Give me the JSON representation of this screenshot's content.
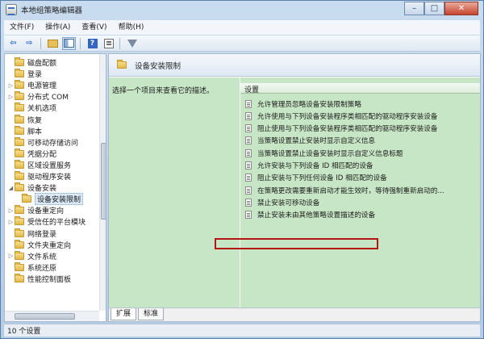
{
  "window": {
    "title": "本地组策略编辑器"
  },
  "caption": {
    "minimize": "–",
    "maximize": "□",
    "close": "✕"
  },
  "menu": [
    "文件(F)",
    "操作(A)",
    "查看(V)",
    "帮助(H)"
  ],
  "toolbar": {
    "icons": [
      "back-arrow-icon",
      "forward-arrow-icon",
      "folder-up-icon",
      "show-hide-tree-icon",
      "help-icon",
      "properties-icon",
      "filter-icon"
    ],
    "back": "⇦",
    "forward": "⇨",
    "help": "?"
  },
  "tree": {
    "items": [
      {
        "label": "磁盘配额",
        "expandable": false
      },
      {
        "label": "登录",
        "expandable": false
      },
      {
        "label": "电源管理",
        "expandable": true
      },
      {
        "label": "分布式 COM",
        "expandable": true
      },
      {
        "label": "关机选项",
        "expandable": false
      },
      {
        "label": "恢复",
        "expandable": false
      },
      {
        "label": "脚本",
        "expandable": false
      },
      {
        "label": "可移动存储访问",
        "expandable": false
      },
      {
        "label": "凭据分配",
        "expandable": false
      },
      {
        "label": "区域设置服务",
        "expandable": false
      },
      {
        "label": "驱动程序安装",
        "expandable": false
      },
      {
        "label": "设备安装",
        "expandable": true,
        "expanded": true
      },
      {
        "label": "设备安装限制",
        "child": true,
        "selected": true
      },
      {
        "label": "设备重定向",
        "expandable": true
      },
      {
        "label": "受信任的平台模块",
        "expandable": true
      },
      {
        "label": "网络登录",
        "expandable": false
      },
      {
        "label": "文件夹重定向",
        "expandable": false
      },
      {
        "label": "文件系统",
        "expandable": true
      },
      {
        "label": "系统还原",
        "expandable": false
      },
      {
        "label": "性能控制面板",
        "expandable": false
      }
    ],
    "expand_closed": "▷",
    "expand_open": "◢"
  },
  "details": {
    "title": "设备安装限制",
    "description": "选择一个项目来查看它的描述。",
    "column_header": "设置",
    "policies": [
      "允许管理员忽略设备安装限制策略",
      "允许使用与下列设备安装程序类相匹配的驱动程序安装设备",
      "阻止使用与下列设备安装程序类相匹配的驱动程序安装设备",
      "当策略设置禁止安装时显示自定义信息",
      "当策略设置禁止设备安装时显示自定义信息标题",
      "允许安装与下列设备 ID 相匹配的设备",
      "阻止安装与下列任何设备 ID 相匹配的设备",
      "在策略更改需要重新启动才能生效时，等待强制重新启动的...",
      "禁止安装可移动设备",
      "禁止安装未由其他策略设置描述的设备"
    ],
    "highlighted_index": 9
  },
  "tabs": [
    {
      "label": "扩展",
      "active": true
    },
    {
      "label": "标准",
      "active": false
    }
  ],
  "status": {
    "text": "10 个设置"
  }
}
